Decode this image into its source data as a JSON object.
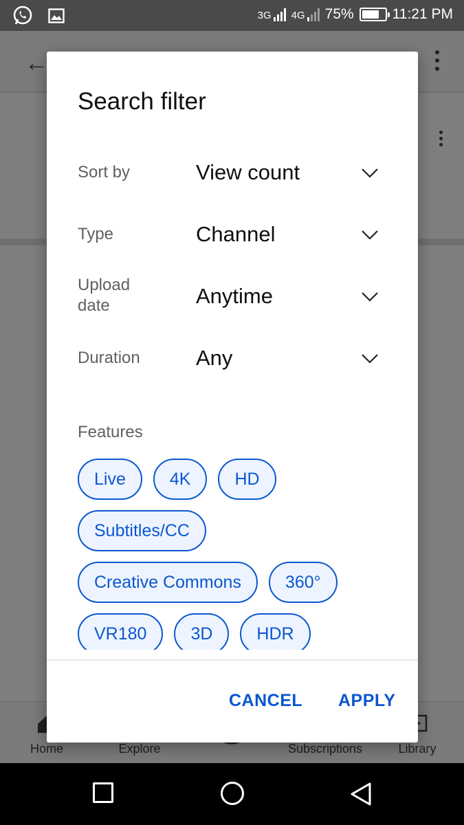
{
  "status_bar": {
    "network_primary": "3G",
    "network_secondary": "4G",
    "battery": "75%",
    "battery_level": 0.75,
    "time": "11:21 PM",
    "left_icons": [
      "whatsapp-icon",
      "image-icon"
    ]
  },
  "bottom_nav": {
    "items": [
      {
        "label": "Home",
        "icon": "home-icon"
      },
      {
        "label": "Explore",
        "icon": "explore-icon"
      },
      {
        "label": "",
        "icon": "create-icon"
      },
      {
        "label": "Subscriptions",
        "icon": "subscriptions-icon"
      },
      {
        "label": "Library",
        "icon": "library-icon"
      }
    ]
  },
  "dialog": {
    "title": "Search filter",
    "filters": [
      {
        "label": "Sort by",
        "value": "View count"
      },
      {
        "label": "Type",
        "value": "Channel"
      },
      {
        "label": "Upload date",
        "value": "Anytime"
      },
      {
        "label": "Duration",
        "value": "Any"
      }
    ],
    "features_label": "Features",
    "feature_chips": [
      [
        "Live",
        "4K",
        "HD"
      ],
      [
        "Subtitles/CC"
      ],
      [
        "Creative Commons",
        "360°"
      ],
      [
        "VR180",
        "3D",
        "HDR"
      ]
    ],
    "cancel_label": "CANCEL",
    "apply_label": "APPLY"
  },
  "colors": {
    "accent": "#0b57d0",
    "chip_bg": "#eef4ff",
    "label_gray": "#606060"
  }
}
